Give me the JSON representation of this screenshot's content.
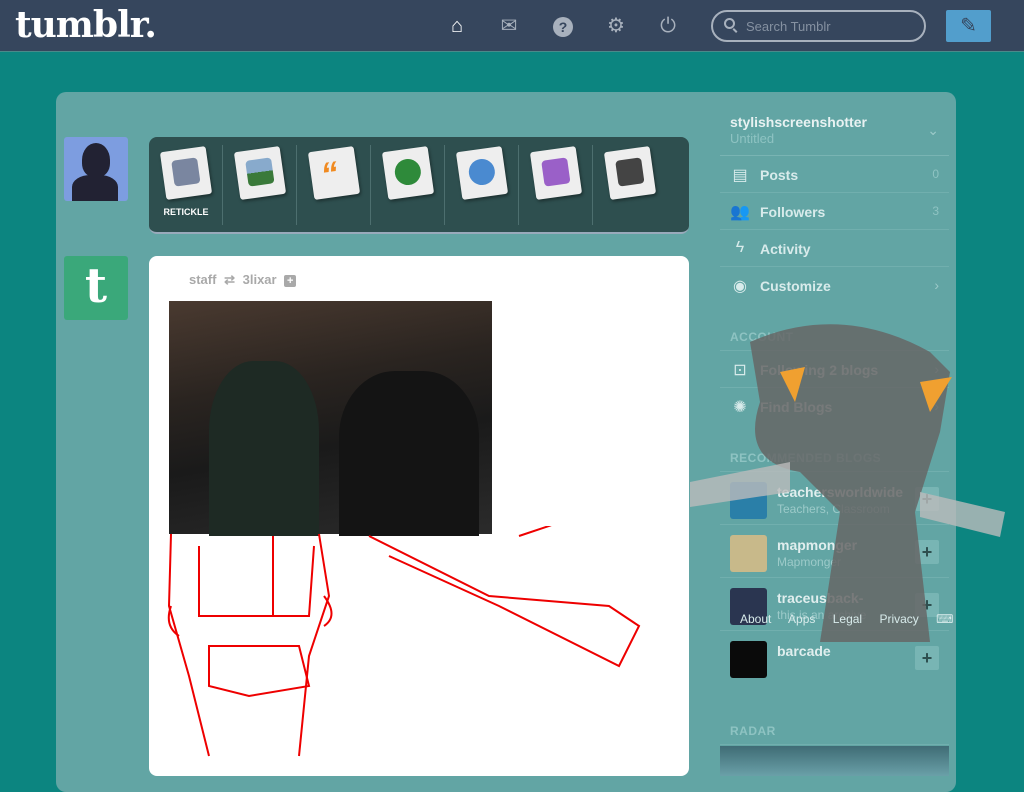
{
  "header": {
    "logo": "tumblr.",
    "nav_icons": [
      "home-icon",
      "mail-icon",
      "help-icon",
      "settings-icon",
      "power-icon"
    ],
    "search_placeholder": "Search Tumblr",
    "compose_icon": "pencil-icon"
  },
  "post_types": [
    {
      "name": "text",
      "label": "RETICKLE"
    },
    {
      "name": "photo",
      "label": ""
    },
    {
      "name": "quote",
      "label": ""
    },
    {
      "name": "link",
      "label": ""
    },
    {
      "name": "chat",
      "label": ""
    },
    {
      "name": "audio",
      "label": ""
    },
    {
      "name": "video",
      "label": ""
    }
  ],
  "post": {
    "author": "staff",
    "reblogged_from": "3lixar"
  },
  "sidebar": {
    "blog_name": "stylishscreenshotter",
    "blog_title": "Untitled",
    "items": [
      {
        "label": "Posts",
        "count": "0",
        "icon": "posts-icon"
      },
      {
        "label": "Followers",
        "count": "3",
        "icon": "followers-icon"
      },
      {
        "label": "Activity",
        "count": "",
        "icon": "lightning-icon"
      },
      {
        "label": "Customize",
        "count": "",
        "icon": "eye-icon"
      }
    ],
    "account_heading": "ACCOUNT",
    "account_items": [
      {
        "label": "Following 2 blogs",
        "icon": "following-icon"
      },
      {
        "label": "Find Blogs",
        "icon": "find-blogs-icon"
      }
    ],
    "recommended_heading": "RECOMMENDED BLOGS",
    "recommended": [
      {
        "name": "teachersworldwide",
        "desc": "Teachers, Classroom",
        "color": "#2a7fa8"
      },
      {
        "name": "mapmonger",
        "desc": "Mapmonger",
        "color": "#c8b98a"
      },
      {
        "name": "traceusback-",
        "desc": "this is an archive",
        "color": "#2a3550"
      },
      {
        "name": "barcade",
        "desc": "",
        "color": "#0a0a0a"
      }
    ],
    "footer_links": [
      "About",
      "Apps",
      "Legal",
      "Privacy"
    ],
    "radar_heading": "RADAR"
  },
  "colors": {
    "header": "#36465d",
    "background": "#0c8580",
    "panel": "#62a5a4",
    "compose": "#529ecc"
  }
}
